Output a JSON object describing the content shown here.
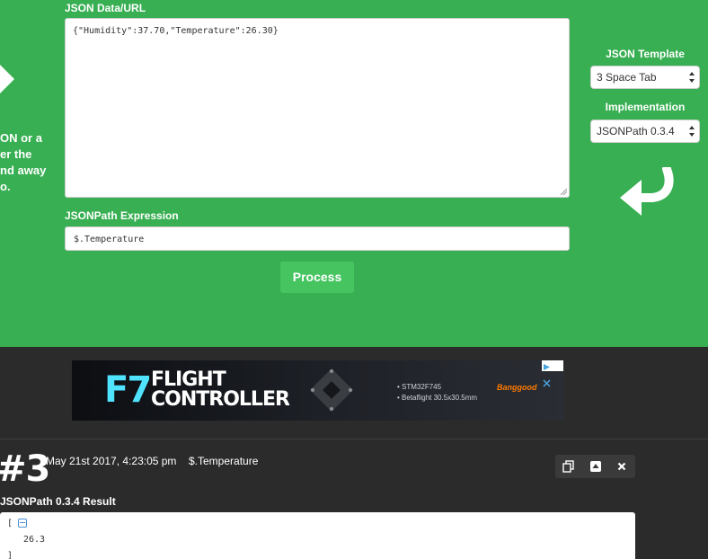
{
  "form": {
    "json_label": "JSON Data/URL",
    "json_value": "{\"Humidity\":37.70,\"Temperature\":26.30}",
    "jsonpath_label": "JSONPath Expression",
    "jsonpath_value": "$.Temperature",
    "process_label": "Process"
  },
  "intro_fragment": [
    "ON or a",
    "er the",
    "nd away",
    "o."
  ],
  "options": {
    "template_label": "JSON Template",
    "template_value": "3 Space Tab",
    "implementation_label": "Implementation",
    "implementation_value": "JSONPath 0.3.4"
  },
  "ad": {
    "logo_text": "F7",
    "title_line1": "FLIGHT",
    "title_line2": "CONTROLLER",
    "bullet1": "STM32F745",
    "bullet2": "Betaflight  30.5x30.5mm",
    "brand": "Banggood"
  },
  "result": {
    "number": "#3",
    "date": "May 21st 2017, 4:23:05 pm",
    "path": "$.Temperature",
    "label": "JSONPath 0.3.4 Result",
    "open_bracket": "[",
    "value": "26.3",
    "close_bracket": "]"
  },
  "colors": {
    "green": "#38af52",
    "button": "#45c460",
    "dark": "#2b2b2b"
  }
}
